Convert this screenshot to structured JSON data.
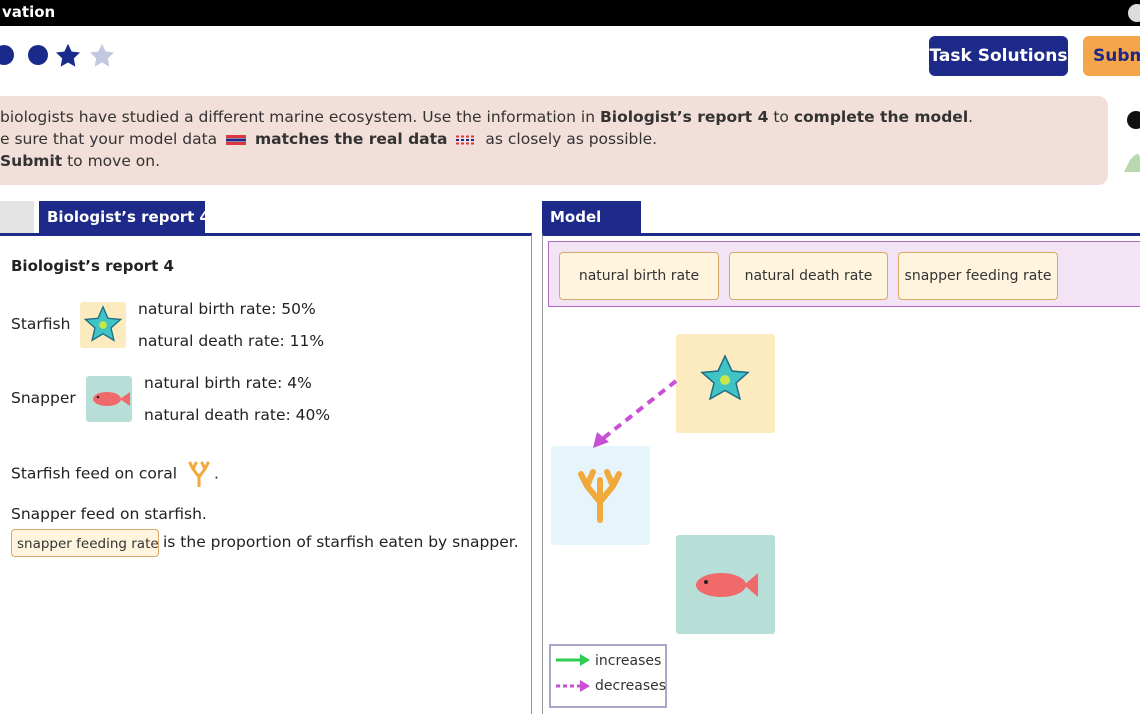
{
  "window": {
    "title": "vation"
  },
  "progress": {
    "completed_dots": 2,
    "stars_filled": 1,
    "stars_empty": 1
  },
  "header": {
    "solutions_label": "Task Solutions",
    "submit_label": "Subm"
  },
  "instructions": {
    "l1_a": "biologists have studied a different marine ecosystem. Use the information in ",
    "l1_b": "Biologist’s report 4",
    "l1_c": " to ",
    "l1_d": "complete the model",
    "l1_e": ".",
    "l2_a": "e sure that your model data",
    "l2_b": "matches the real data",
    "l2_c": "as closely as possible.",
    "l3_a": "Submit",
    "l3_b": " to move on."
  },
  "left": {
    "tab_label": "Biologist’s report 4",
    "report_title": "Biologist’s report 4",
    "starfish": {
      "name": "Starfish",
      "birth": "natural birth rate: 50%",
      "death": "natural death rate: 11%"
    },
    "snapper": {
      "name": "Snapper",
      "birth": "natural birth rate: 4%",
      "death": "natural death rate: 40%"
    },
    "coral_line": "Starfish feed on coral",
    "coral_end": ".",
    "snapper_line": "Snapper feed on starfish.",
    "chip": "snapper feeding rate",
    "chip_after": "is the proportion of starfish eaten by snapper."
  },
  "model": {
    "tab_label": "Model",
    "chips": [
      "natural birth rate",
      "natural death rate",
      "snapper feeding rate"
    ],
    "legend": {
      "increases": "increases",
      "decreases": "decreases"
    }
  },
  "colors": {
    "navy": "#1d2a8a",
    "orange": "#f5a54a",
    "instruction_bg": "#f3dfd9",
    "starfish_tile": "#fcebbe",
    "coral_tile": "#e6f4fb",
    "snapper_tile": "#b8ded8",
    "increases": "#2ecc51",
    "decreases": "#c94fd6"
  }
}
